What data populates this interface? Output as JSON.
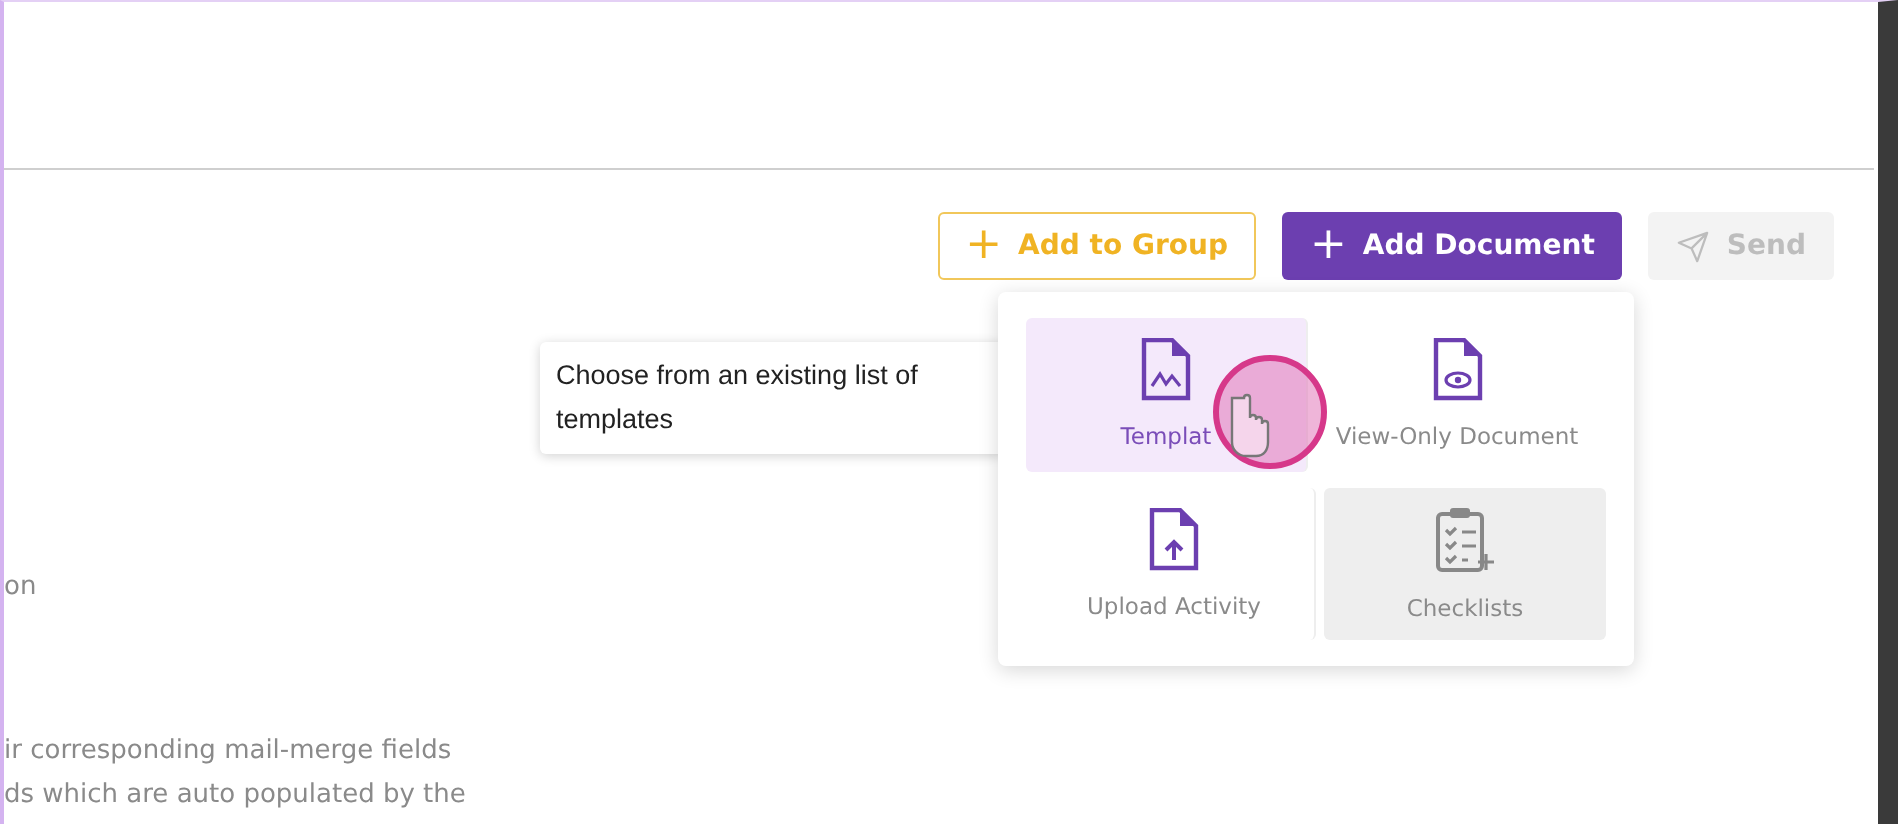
{
  "toolbar": {
    "add_to_group": {
      "label": "Add to Group",
      "icon": "+"
    },
    "add_document": {
      "label": "Add Document",
      "icon": "+"
    },
    "send": {
      "label": "Send",
      "disabled": true
    }
  },
  "tooltip": {
    "text": "Choose from an existing list of templates"
  },
  "menu": {
    "items": [
      {
        "label": "Templat",
        "kind": "template",
        "selected": true,
        "hovered": false
      },
      {
        "label": "View-Only Document",
        "kind": "view",
        "selected": false,
        "hovered": false
      },
      {
        "label": "Upload Activity",
        "kind": "upload",
        "selected": false,
        "hovered": false
      },
      {
        "label": "Checklists",
        "kind": "checklist",
        "selected": false,
        "hovered": true
      }
    ]
  },
  "body_text": [
    "on",
    "ir corresponding mail-merge fields",
    "ds which are auto populated by the"
  ]
}
